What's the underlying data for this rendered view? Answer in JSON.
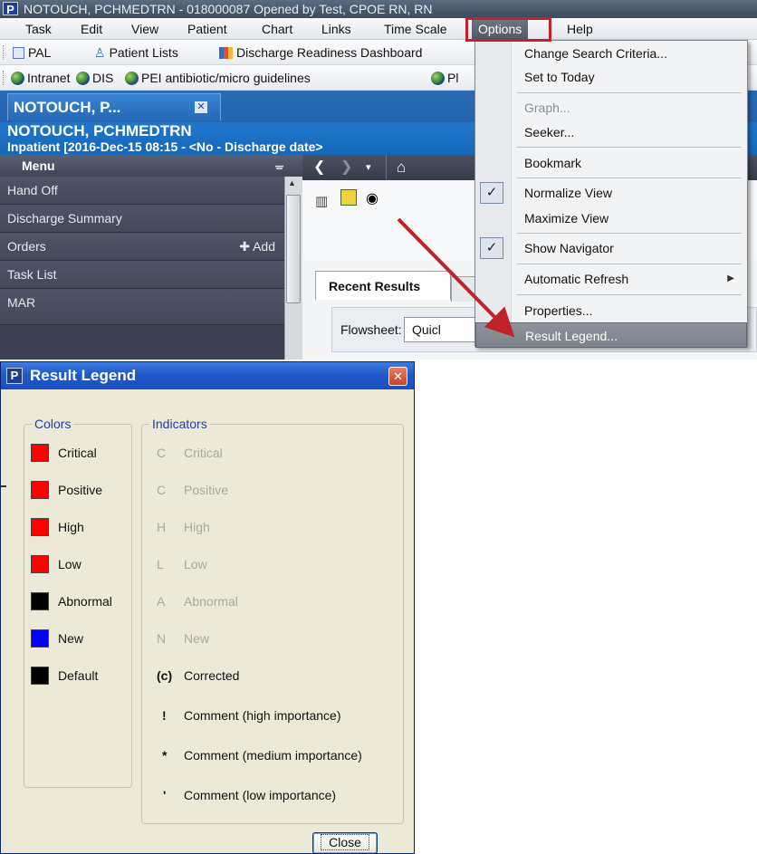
{
  "window": {
    "title": "NOTOUCH, PCHMEDTRN - 018000087 Opened by Test, CPOE RN, RN",
    "logo": "P"
  },
  "menubar": {
    "items": [
      "Task",
      "Edit",
      "View",
      "Patient",
      "Chart",
      "Links",
      "Time Scale",
      "Options",
      "Help"
    ]
  },
  "toolbar1": {
    "items": [
      "PAL",
      "Patient Lists",
      "Discharge Readiness Dashboard"
    ]
  },
  "toolbar2": {
    "items": [
      "Intranet",
      "DIS",
      "PEI antibiotic/micro guidelines",
      "Pl"
    ]
  },
  "patient": {
    "tab": "NOTOUCH, P...",
    "name": "NOTOUCH, PCHMEDTRN",
    "encounter": "Inpatient [2016-Dec-15 08:15 - <No - Discharge date>"
  },
  "nav": {
    "header": "Menu",
    "items": [
      "Hand Off",
      "Discharge Summary",
      "Orders",
      "Task List",
      "MAR"
    ],
    "add_label": "Add"
  },
  "content": {
    "tab_recent": "Recent Results",
    "flowsheet_label": "Flowsheet:",
    "flowsheet_value": "Quicl"
  },
  "options_menu": {
    "items": [
      {
        "label": "Change Search Criteria...",
        "disabled": false
      },
      {
        "label": "Set to Today",
        "disabled": false
      },
      {
        "label": "Graph...",
        "disabled": true
      },
      {
        "label": "Seeker...",
        "disabled": false
      },
      {
        "label": "Bookmark",
        "disabled": false
      },
      {
        "label": "Normalize View",
        "checked": true
      },
      {
        "label": "Maximize View",
        "checked": false
      },
      {
        "label": "Show Navigator",
        "checked": true
      },
      {
        "label": "Automatic Refresh",
        "submenu": true
      },
      {
        "label": "Properties...",
        "disabled": false
      },
      {
        "label": "Result Legend...",
        "highlighted": true
      }
    ]
  },
  "dialog": {
    "title": "Result Legend",
    "colors_title": "Colors",
    "indicators_title": "Indicators",
    "colors": [
      {
        "label": "Critical",
        "color": "#ff0000"
      },
      {
        "label": "Positive",
        "color": "#ff0000"
      },
      {
        "label": "High",
        "color": "#ff0000"
      },
      {
        "label": "Low",
        "color": "#ff0000"
      },
      {
        "label": "Abnormal",
        "color": "#000000"
      },
      {
        "label": "New",
        "color": "#0000ff"
      },
      {
        "label": "Default",
        "color": "#000000"
      }
    ],
    "indicators": [
      {
        "symbol": "C",
        "label": "Critical",
        "enabled": false
      },
      {
        "symbol": "C",
        "label": "Positive",
        "enabled": false
      },
      {
        "symbol": "H",
        "label": "High",
        "enabled": false
      },
      {
        "symbol": "L",
        "label": "Low",
        "enabled": false
      },
      {
        "symbol": "A",
        "label": "Abnormal",
        "enabled": false
      },
      {
        "symbol": "N",
        "label": "New",
        "enabled": false
      },
      {
        "symbol": "(c)",
        "label": "Corrected",
        "enabled": true
      },
      {
        "symbol": "!",
        "label": "Comment (high importance)",
        "enabled": true
      },
      {
        "symbol": "*",
        "label": "Comment (medium importance)",
        "enabled": true
      },
      {
        "symbol": "'",
        "label": "Comment (low importance)",
        "enabled": true
      }
    ],
    "close_label": "Close"
  },
  "accent": {
    "annotation": "#c0232a",
    "patient_blue": "#1f77cc"
  }
}
